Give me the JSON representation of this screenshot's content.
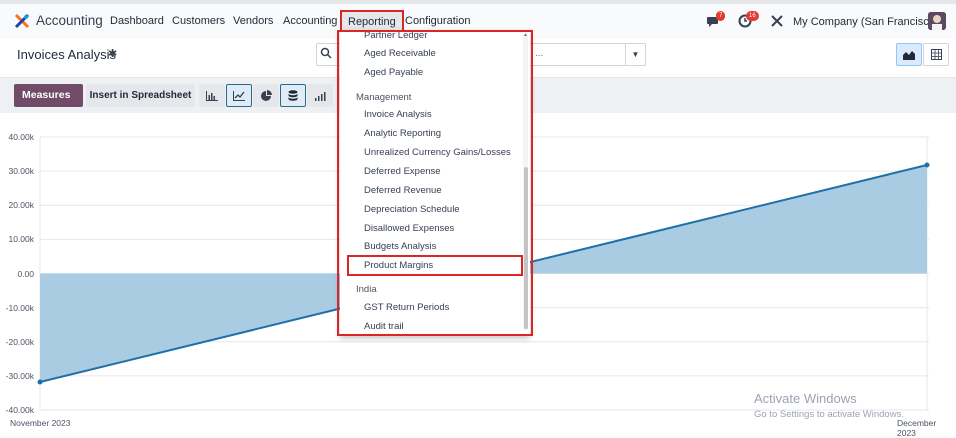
{
  "navbar": {
    "app_name": "Accounting",
    "items": [
      {
        "label": "Dashboard"
      },
      {
        "label": "Customers"
      },
      {
        "label": "Vendors"
      },
      {
        "label": "Accounting"
      },
      {
        "label": "Reporting"
      },
      {
        "label": "Configuration"
      }
    ],
    "messages_count": "7",
    "activities_count": "16",
    "company": "My Company (San Francisco)"
  },
  "control_panel": {
    "title": "Invoices Analysis",
    "search_placeholder": "..."
  },
  "toolbar": {
    "measures_label": "Measures",
    "insert_label": "Insert in Spreadsheet"
  },
  "chart_data": {
    "type": "line",
    "x": [
      "November 2023",
      "December 2023"
    ],
    "series": [
      {
        "values": [
          -31800,
          31800
        ]
      }
    ],
    "ylim": [
      -40000,
      40000
    ],
    "yticks": [
      "40.00k",
      "30.00k",
      "20.00k",
      "10.00k",
      "0.00",
      "-10.00k",
      "-20.00k",
      "-30.00k",
      "-40.00k"
    ],
    "fill": "area",
    "colors": {
      "line": "#1f6fa8",
      "fill": "#a9cce3"
    },
    "grid": true
  },
  "dropdown": {
    "partial_top": "Partner Ledger",
    "items_top": [
      "Aged Receivable",
      "Aged Payable"
    ],
    "sections": [
      {
        "header": "Management",
        "items": [
          "Invoice Analysis",
          "Analytic Reporting",
          "Unrealized Currency Gains/Losses",
          "Deferred Expense",
          "Deferred Revenue",
          "Depreciation Schedule",
          "Disallowed Expenses",
          "Budgets Analysis",
          "Product Margins"
        ]
      },
      {
        "header": "India",
        "items": [
          "GST Return Periods",
          "Audit trail"
        ]
      }
    ]
  },
  "watermark": {
    "line1": "Activate Windows",
    "line2": "Go to Settings to activate Windows."
  }
}
